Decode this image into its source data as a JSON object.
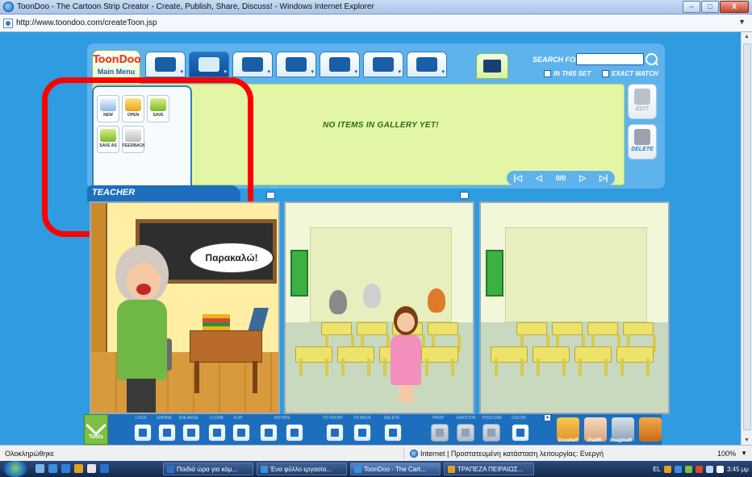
{
  "window": {
    "title": "ToonDoo - The Cartoon Strip Creator - Create, Publish, Share, Discuss! - Windows Internet Explorer",
    "minimize_label": "–",
    "maximize_label": "□",
    "close_label": "X"
  },
  "address": {
    "url": "http://www.toondoo.com/createToon.jsp"
  },
  "app": {
    "logo": "ToonDoo",
    "main_menu_label": "Main Menu",
    "search_label": "SEARCH FOR",
    "search_value": "",
    "in_this_set": "IN THIS SET",
    "exact_match": "EXACT MATCH",
    "gallery_message": "NO ITEMS IN GALLERY YET!",
    "edit_label": "EDIT",
    "delete_label": "DELETE",
    "pager_text": "0/0",
    "menu_items": [
      "NEW",
      "OPEN",
      "SAVE",
      "SAVE AS",
      "FEEDBACK"
    ],
    "tabs": [
      "characters",
      "backgrounds",
      "props",
      "speech-bubbles",
      "scenes",
      "special-effects",
      "books"
    ]
  },
  "strip": {
    "teacher_tab": "TEACHER",
    "speech_text": "Παρακαλώ!"
  },
  "toolbar": {
    "tools_label": "Tools",
    "lock": "LOCK",
    "shrink": "SHRINK",
    "enlarge": "ENLARGE",
    "clone": "CLONE",
    "flip": "FLIP",
    "rotate": "ROTATE",
    "to_front": "TO FRONT",
    "to_back": "TO BACK",
    "delete": "DELETE",
    "prop": "PROP",
    "emotion": "EMOTION",
    "posture": "POSTURE",
    "color": "COLOR",
    "doodler": "DoodleR",
    "traitr": "TraitR",
    "imaginer": "ImagineR"
  },
  "status": {
    "left_text": "Ολοκληρώθηκε",
    "zone_text": "Internet | Προστατευμένη κατάσταση λειτουργίας: Ενεργή",
    "zoom": "100%"
  },
  "taskbar": {
    "tasks": [
      {
        "label": "Παιδιά ώρα για κόμ...",
        "color": "#2b6fd0"
      },
      {
        "label": "Ένα φύλλο εργασία...",
        "color": "#3a8fe0"
      },
      {
        "label": "ToonDoo - The Cart...",
        "color": "#3a8fe0"
      },
      {
        "label": "ΤΡΑΠΕΖΑ ΠΕΙΡΑΙΩΣ...",
        "color": "#e0a020"
      }
    ],
    "language": "EL",
    "clock": "3:45 μμ"
  },
  "colors": {
    "app_blue": "#2f9be0",
    "gallery_green": "#e2f6a5",
    "highlight_red": "#ff0000"
  }
}
